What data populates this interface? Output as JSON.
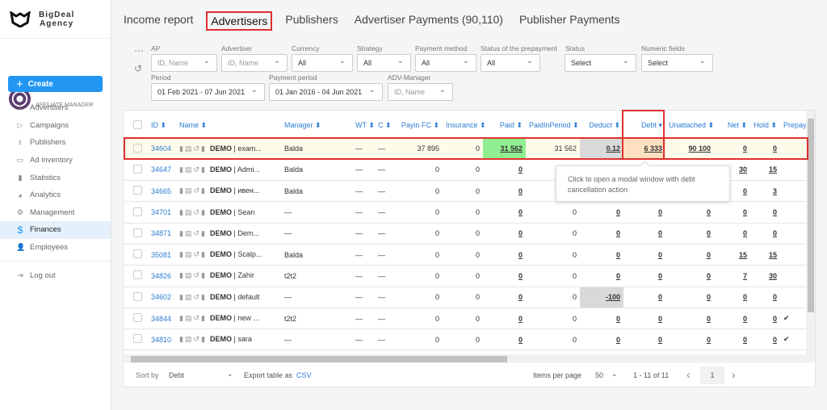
{
  "brand": {
    "line1": "BigDeal",
    "line2": "Agency"
  },
  "sidebar": {
    "role": "AFFILIATE MANAGER",
    "create": "Create",
    "items": [
      {
        "label": "Advertisers",
        "icon": "upload-icon"
      },
      {
        "label": "Campaigns",
        "icon": "play-circle-icon"
      },
      {
        "label": "Publishers",
        "icon": "download-icon"
      },
      {
        "label": "Ad inventory",
        "icon": "window-icon"
      },
      {
        "label": "Statistics",
        "icon": "bar-chart-icon"
      },
      {
        "label": "Analytics",
        "icon": "pie-chart-icon"
      },
      {
        "label": "Management",
        "icon": "gear-icon"
      },
      {
        "label": "Finances",
        "icon": "dollar-icon",
        "active": true
      },
      {
        "label": "Employees",
        "icon": "users-icon"
      }
    ],
    "logout": "Log out"
  },
  "tabs": [
    "Income report",
    "Advertisers",
    "Publishers",
    "Advertiser Payments (90,110)",
    "Publisher Payments"
  ],
  "active_tab": "Advertisers",
  "filters": {
    "ap": {
      "label": "AP",
      "placeholder": "ID, Name"
    },
    "advertiser": {
      "label": "Advertiser",
      "placeholder": "ID, Name"
    },
    "currency": {
      "label": "Currency",
      "value": "All"
    },
    "strategy": {
      "label": "Strategy",
      "value": "All"
    },
    "payment_method": {
      "label": "Payment method",
      "value": "All"
    },
    "prepayment_status": {
      "label": "Status of the prepayment",
      "value": "All"
    },
    "status": {
      "label": "Status",
      "value": "Select"
    },
    "numeric": {
      "label": "Numeric fields",
      "value": "Select"
    },
    "period": {
      "label": "Period",
      "value": "01 Feb 2021 - 07 Jun 2021"
    },
    "payment_period": {
      "label": "Payment period",
      "value": "01 Jan 2016 - 04 Jun 2021"
    },
    "adv_manager": {
      "label": "ADV-Manager",
      "placeholder": "ID, Name"
    }
  },
  "table": {
    "columns": [
      "ID",
      "Name",
      "Manager",
      "WT",
      "C",
      "Payin FC",
      "Insurance",
      "Paid",
      "PaidInPeriod",
      "Deduct",
      "Debt",
      "Unattached",
      "Net",
      "Hold",
      "Prepay"
    ],
    "sort_column": "Debt",
    "rows": [
      {
        "id": "34604",
        "demo": "DEMO",
        "name": "| exam...",
        "manager": "Balda",
        "wt": "—",
        "c": "—",
        "payin": "37 895",
        "insurance": "0",
        "paid": "31 562",
        "pip": "31 562",
        "deduct": "0.12",
        "debt": "6 333",
        "unattached": "90 100",
        "net": "0",
        "hold": "0",
        "prepay": ""
      },
      {
        "id": "34647",
        "demo": "DEMO",
        "name": "| Admi...",
        "manager": "Balda",
        "wt": "—",
        "c": "—",
        "payin": "0",
        "insurance": "0",
        "paid": "0",
        "pip": "",
        "deduct": "",
        "debt": "",
        "unattached": "",
        "net": "30",
        "hold": "15",
        "prepay": ""
      },
      {
        "id": "34665",
        "demo": "DEMO",
        "name": "| ивен...",
        "manager": "Balda",
        "wt": "—",
        "c": "—",
        "payin": "0",
        "insurance": "0",
        "paid": "0",
        "pip": "",
        "deduct": "",
        "debt": "",
        "unattached": "",
        "net": "0",
        "hold": "3",
        "prepay": ""
      },
      {
        "id": "34701",
        "demo": "DEMO",
        "name": "| Sean",
        "manager": "—",
        "wt": "—",
        "c": "—",
        "payin": "0",
        "insurance": "0",
        "paid": "0",
        "pip": "0",
        "deduct": "0",
        "debt": "0",
        "unattached": "0",
        "net": "0",
        "hold": "0",
        "prepay": ""
      },
      {
        "id": "34871",
        "demo": "DEMO",
        "name": "| Dem...",
        "manager": "—",
        "wt": "—",
        "c": "—",
        "payin": "0",
        "insurance": "0",
        "paid": "0",
        "pip": "0",
        "deduct": "0",
        "debt": "0",
        "unattached": "0",
        "net": "0",
        "hold": "0",
        "prepay": ""
      },
      {
        "id": "35081",
        "demo": "DEMO",
        "name": "| Scalp...",
        "manager": "Balda",
        "wt": "—",
        "c": "—",
        "payin": "0",
        "insurance": "0",
        "paid": "0",
        "pip": "0",
        "deduct": "0",
        "debt": "0",
        "unattached": "0",
        "net": "15",
        "hold": "15",
        "prepay": ""
      },
      {
        "id": "34826",
        "demo": "DEMO",
        "name": "| Zahir",
        "manager": "t2t2",
        "wt": "—",
        "c": "—",
        "payin": "0",
        "insurance": "0",
        "paid": "0",
        "pip": "0",
        "deduct": "0",
        "debt": "0",
        "unattached": "0",
        "net": "7",
        "hold": "30",
        "prepay": ""
      },
      {
        "id": "34602",
        "demo": "DEMO",
        "name": "| default",
        "manager": "—",
        "wt": "—",
        "c": "—",
        "payin": "0",
        "insurance": "0",
        "paid": "0",
        "pip": "0",
        "deduct": "-100",
        "debt": "0",
        "unattached": "0",
        "net": "0",
        "hold": "0",
        "prepay": ""
      },
      {
        "id": "34844",
        "demo": "DEMO",
        "name": "| new ...",
        "manager": "t2t2",
        "wt": "—",
        "c": "—",
        "payin": "0",
        "insurance": "0",
        "paid": "0",
        "pip": "0",
        "deduct": "0",
        "debt": "0",
        "unattached": "0",
        "net": "0",
        "hold": "0",
        "prepay": "✔"
      },
      {
        "id": "34810",
        "demo": "DEMO",
        "name": "| sara",
        "manager": "—",
        "wt": "—",
        "c": "—",
        "payin": "0",
        "insurance": "0",
        "paid": "0",
        "pip": "0",
        "deduct": "0",
        "debt": "0",
        "unattached": "0",
        "net": "0",
        "hold": "0",
        "prepay": "✔"
      }
    ]
  },
  "tooltip": "Click to open a modal window with debt cancellation action",
  "footer": {
    "sort_label": "Sort by",
    "sort_value": "Debt",
    "export_label": "Export table as",
    "export_link": "CSV",
    "ipp_label": "Items per page",
    "ipp_value": "50",
    "range": "1 - 11 of 11",
    "page": "1"
  },
  "colors": {
    "accent": "#2196f3",
    "paid_bg": "#90ee90",
    "deduct_bg": "#d9d9d9",
    "debt_bg": "#fde0c0",
    "highlight": "#e03030"
  }
}
